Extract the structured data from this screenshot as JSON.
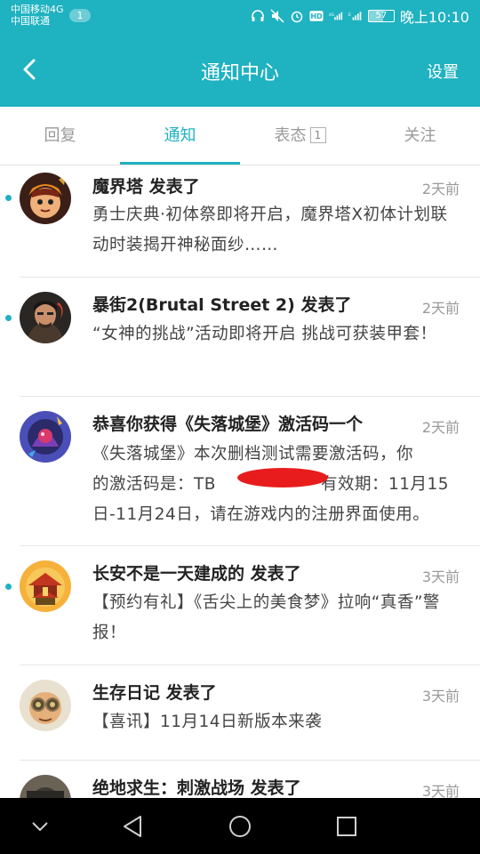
{
  "status_bar": {
    "carrier_1": "中国移动4G",
    "carrier_2": "中国联通",
    "sim_badge": "1",
    "battery_level": "57",
    "clock": "晚上10:10",
    "icons": [
      "headphones-icon",
      "mute-icon",
      "alarm-icon",
      "hd-icon",
      "signal-4g-icon",
      "signal-bars-icon",
      "signal-e-icon",
      "battery-icon"
    ]
  },
  "header": {
    "title": "通知中心",
    "settings_label": "设置",
    "back_icon": "back-arrow-icon"
  },
  "tabs": [
    {
      "label": "回复",
      "active": false
    },
    {
      "label": "通知",
      "active": true
    },
    {
      "label": "表态",
      "badge": "1",
      "active": false
    },
    {
      "label": "关注",
      "active": false
    }
  ],
  "notifications": [
    {
      "title": "魔界塔 发表了",
      "time": "2天前",
      "body": "勇士庆典·初体祭即将开启，魔界塔X初体计划联动时装揭开神秘面纱……",
      "unread": true
    },
    {
      "title": "暴街2(Brutal Street 2) 发表了",
      "time": "2天前",
      "body": "“女神的挑战”活动即将开启 挑战可获装甲套！",
      "unread": true
    },
    {
      "title": "恭喜你获得《失落城堡》激活码一个",
      "time": "2天前",
      "body_line1": "《失落城堡》本次删档测试需要激活码，你",
      "body_line2_a": "的激活码是：TB",
      "body_line2_b": "有效期：11月15",
      "body_line3": "日-11月24日，请在游戏内的注册界面使用。",
      "unread": false
    },
    {
      "title": "长安不是一天建成的 发表了",
      "time": "3天前",
      "body": "【预约有礼】《舌尖上的美食梦》拉响“真香”警报！",
      "unread": true
    },
    {
      "title": "生存日记 发表了",
      "time": "3天前",
      "body": "【喜讯】11月14日新版本来袭",
      "unread": false
    },
    {
      "title": "绝地求生：刺激战场 发表了",
      "time": "3天前",
      "unread": false
    }
  ],
  "nav_bar": {
    "icons": [
      "collapse-chevron-icon",
      "back-triangle-icon",
      "home-circle-icon",
      "recents-square-icon"
    ]
  }
}
